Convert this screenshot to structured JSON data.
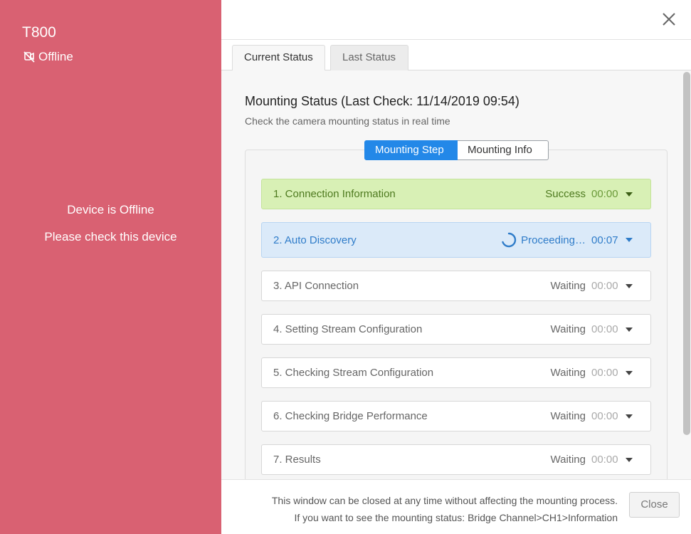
{
  "device": {
    "name": "T800",
    "status": "Offline",
    "message_line1": "Device is Offline",
    "message_line2": "Please check this device"
  },
  "tabs": [
    {
      "label": "Current Status",
      "active": true
    },
    {
      "label": "Last Status",
      "active": false
    }
  ],
  "mounting": {
    "title": "Mounting Status (Last Check: 11/14/2019 09:54)",
    "subtitle": "Check the camera mounting status in real time"
  },
  "segments": [
    {
      "label": "Mounting Step",
      "active": true
    },
    {
      "label": "Mounting Info",
      "active": false
    }
  ],
  "steps": [
    {
      "label": "1. Connection Information",
      "state": "Success",
      "time": "00:00"
    },
    {
      "label": "2. Auto Discovery",
      "state": "Proceeding…",
      "time": "00:07"
    },
    {
      "label": "3. API Connection",
      "state": "Waiting",
      "time": "00:00"
    },
    {
      "label": "4. Setting Stream Configuration",
      "state": "Waiting",
      "time": "00:00"
    },
    {
      "label": "5. Checking Stream Configuration",
      "state": "Waiting",
      "time": "00:00"
    },
    {
      "label": "6. Checking Bridge Performance",
      "state": "Waiting",
      "time": "00:00"
    },
    {
      "label": "7. Results",
      "state": "Waiting",
      "time": "00:00"
    }
  ],
  "footer": {
    "line1": "This window can be closed at any time without affecting the mounting process.",
    "line2": "If you want to see the mounting status: Bridge Channel>CH1>Information",
    "close_label": "Close"
  },
  "colors": {
    "sidebar": "#d96172",
    "accent": "#2388e8",
    "success_bg": "#d8f0b5",
    "proceeding_bg": "#dbeaf9"
  },
  "icons": {
    "status": "video-off-icon",
    "close": "close-icon",
    "spinner": "spinner-icon",
    "caret": "caret-down-icon"
  }
}
